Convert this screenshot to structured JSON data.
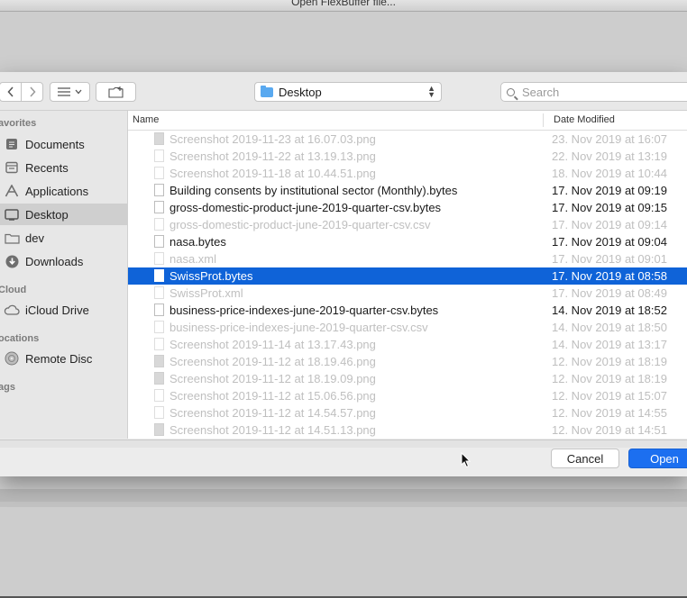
{
  "window": {
    "title": "Open FlexBuffer file..."
  },
  "toolbar": {
    "location": "Desktop",
    "search_placeholder": "Search"
  },
  "sidebar": {
    "sections": [
      {
        "label": "avorites"
      },
      {
        "label": "Cloud"
      },
      {
        "label": "ocations"
      },
      {
        "label": "ags"
      }
    ],
    "items": [
      {
        "label": "Documents",
        "icon": "documents-icon"
      },
      {
        "label": "Recents",
        "icon": "recents-icon"
      },
      {
        "label": "Applications",
        "icon": "applications-icon"
      },
      {
        "label": "Desktop",
        "icon": "desktop-icon",
        "selected": true
      },
      {
        "label": "dev",
        "icon": "folder-icon"
      },
      {
        "label": "Downloads",
        "icon": "downloads-icon"
      },
      {
        "label": "iCloud Drive",
        "icon": "cloud-icon"
      },
      {
        "label": "Remote Disc",
        "icon": "disc-icon"
      }
    ]
  },
  "filelist": {
    "columns": {
      "name": "Name",
      "date": "Date Modified"
    },
    "rows": [
      {
        "name": "Screenshot 2019-11-23 at 16.07.03.png",
        "date": "23. Nov 2019 at 16:07",
        "dim": true,
        "img": true
      },
      {
        "name": "Screenshot 2019-11-22 at 13.19.13.png",
        "date": "22. Nov 2019 at 13:19",
        "dim": true
      },
      {
        "name": "Screenshot 2019-11-18 at 10.44.51.png",
        "date": "18. Nov 2019 at 10:44",
        "dim": true
      },
      {
        "name": "Building consents by institutional sector (Monthly).bytes",
        "date": "17. Nov 2019 at 09:19"
      },
      {
        "name": "gross-domestic-product-june-2019-quarter-csv.bytes",
        "date": "17. Nov 2019 at 09:15"
      },
      {
        "name": "gross-domestic-product-june-2019-quarter-csv.csv",
        "date": "17. Nov 2019 at 09:14",
        "dim": true
      },
      {
        "name": "nasa.bytes",
        "date": "17. Nov 2019 at 09:04"
      },
      {
        "name": "nasa.xml",
        "date": "17. Nov 2019 at 09:01",
        "dim": true
      },
      {
        "name": "SwissProt.bytes",
        "date": "17. Nov 2019 at 08:58",
        "selected": true
      },
      {
        "name": "SwissProt.xml",
        "date": "17. Nov 2019 at 08:49",
        "dim": true
      },
      {
        "name": "business-price-indexes-june-2019-quarter-csv.bytes",
        "date": "14. Nov 2019 at 18:52"
      },
      {
        "name": "business-price-indexes-june-2019-quarter-csv.csv",
        "date": "14. Nov 2019 at 18:50",
        "dim": true
      },
      {
        "name": "Screenshot 2019-11-14 at 13.17.43.png",
        "date": "14. Nov 2019 at 13:17",
        "dim": true
      },
      {
        "name": "Screenshot 2019-11-12 at 18.19.46.png",
        "date": "12. Nov 2019 at 18:19",
        "dim": true,
        "img": true
      },
      {
        "name": "Screenshot 2019-11-12 at 18.19.09.png",
        "date": "12. Nov 2019 at 18:19",
        "dim": true,
        "img": true
      },
      {
        "name": "Screenshot 2019-11-12 at 15.06.56.png",
        "date": "12. Nov 2019 at 15:07",
        "dim": true
      },
      {
        "name": "Screenshot 2019-11-12 at 14.54.57.png",
        "date": "12. Nov 2019 at 14:55",
        "dim": true
      },
      {
        "name": "Screenshot 2019-11-12 at 14.51.13.png",
        "date": "12. Nov 2019 at 14:51",
        "dim": true,
        "img": true
      }
    ]
  },
  "buttons": {
    "cancel": "Cancel",
    "open": "Open"
  },
  "colors": {
    "selection": "#0f63d8",
    "accent": "#1c6ff0",
    "folder": "#59a9f0"
  }
}
